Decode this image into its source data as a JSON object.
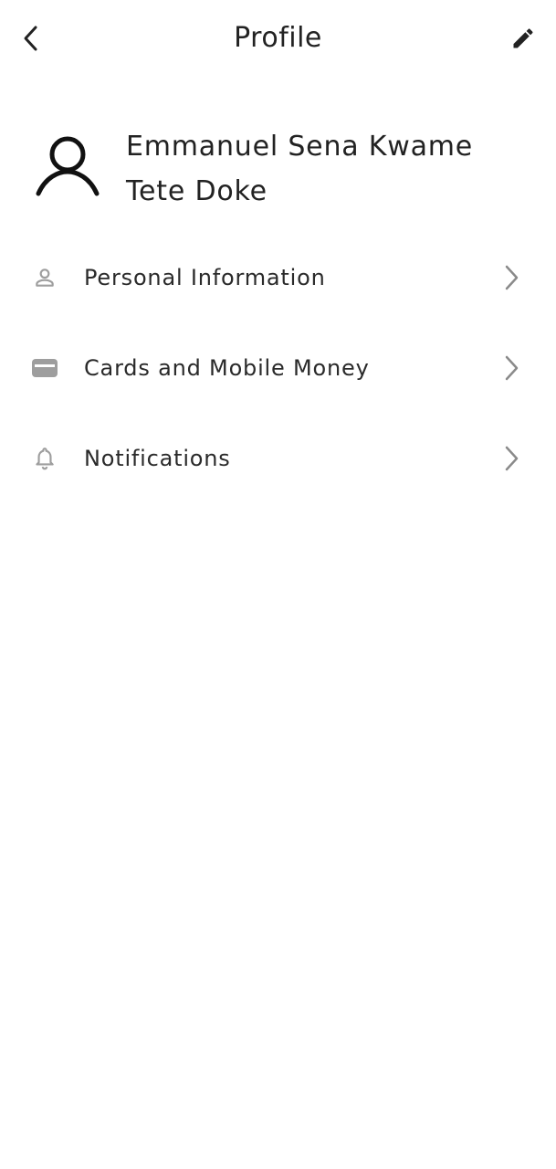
{
  "header": {
    "title": "Profile",
    "back_icon": "chevron-left-icon",
    "edit_icon": "pencil-icon"
  },
  "profile": {
    "avatar_icon": "user-outline-icon",
    "name": "Emmanuel Sena Kwame Tete Doke"
  },
  "menu": {
    "items": [
      {
        "label": "Personal Information",
        "icon": "person-icon"
      },
      {
        "label": "Cards and Mobile Money",
        "icon": "card-icon"
      },
      {
        "label": "Notifications",
        "icon": "bell-icon"
      }
    ],
    "chevron_icon": "chevron-right-icon"
  },
  "colors": {
    "text": "#222222",
    "icon_muted": "#9e9e9e",
    "background": "#ffffff"
  }
}
